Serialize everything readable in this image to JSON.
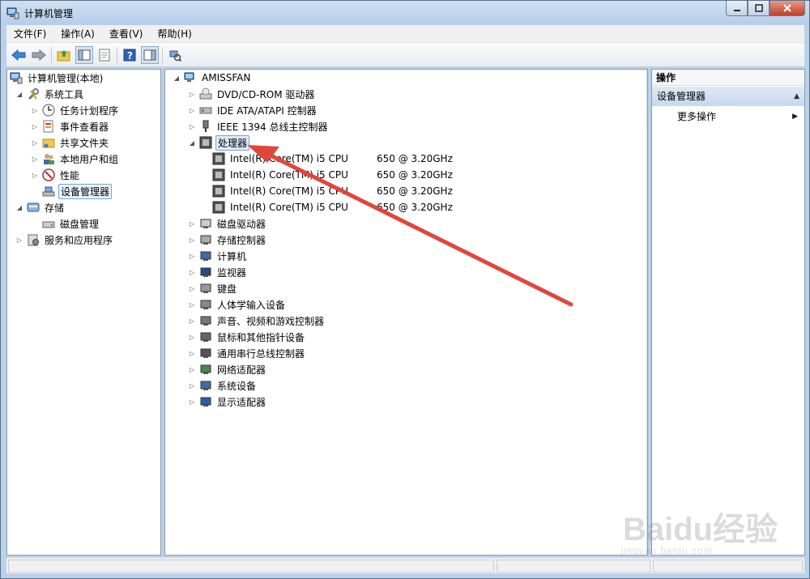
{
  "window": {
    "title": "计算机管理"
  },
  "menu": [
    "文件(F)",
    "操作(A)",
    "查看(V)",
    "帮助(H)"
  ],
  "left_tree": {
    "root": "计算机管理(本地)",
    "system_tools": "系统工具",
    "children": [
      "任务计划程序",
      "事件查看器",
      "共享文件夹",
      "本地用户和组",
      "性能",
      "设备管理器"
    ],
    "storage": "存储",
    "storage_children": [
      "磁盘管理"
    ],
    "services": "服务和应用程序"
  },
  "device_tree": {
    "root": "AMISSFAN",
    "categories_before": [
      "DVD/CD-ROM 驱动器",
      "IDE ATA/ATAPI 控制器",
      "IEEE 1394 总线主控制器"
    ],
    "processor_category": "处理器",
    "cpus": [
      {
        "name": "Intel(R) Core(TM) i5 CPU",
        "model": "650  @ 3.20GHz"
      },
      {
        "name": "Intel(R) Core(TM) i5 CPU",
        "model": "650  @ 3.20GHz"
      },
      {
        "name": "Intel(R) Core(TM) i5 CPU",
        "model": "650  @ 3.20GHz"
      },
      {
        "name": "Intel(R) Core(TM) i5 CPU",
        "model": "650  @ 3.20GHz"
      }
    ],
    "categories_after": [
      "磁盘驱动器",
      "存储控制器",
      "计算机",
      "监视器",
      "键盘",
      "人体学输入设备",
      "声音、视频和游戏控制器",
      "鼠标和其他指针设备",
      "通用串行总线控制器",
      "网络适配器",
      "系统设备",
      "显示适配器"
    ]
  },
  "actions": {
    "header": "操作",
    "section": "设备管理器",
    "more": "更多操作"
  },
  "watermark": {
    "brand": "Baidu经验",
    "url": "jingyan.baidu.com"
  },
  "colors": {
    "arrow": "#e0473c",
    "selection": "#dcebfc",
    "titlebar": "#b9d1ea"
  }
}
